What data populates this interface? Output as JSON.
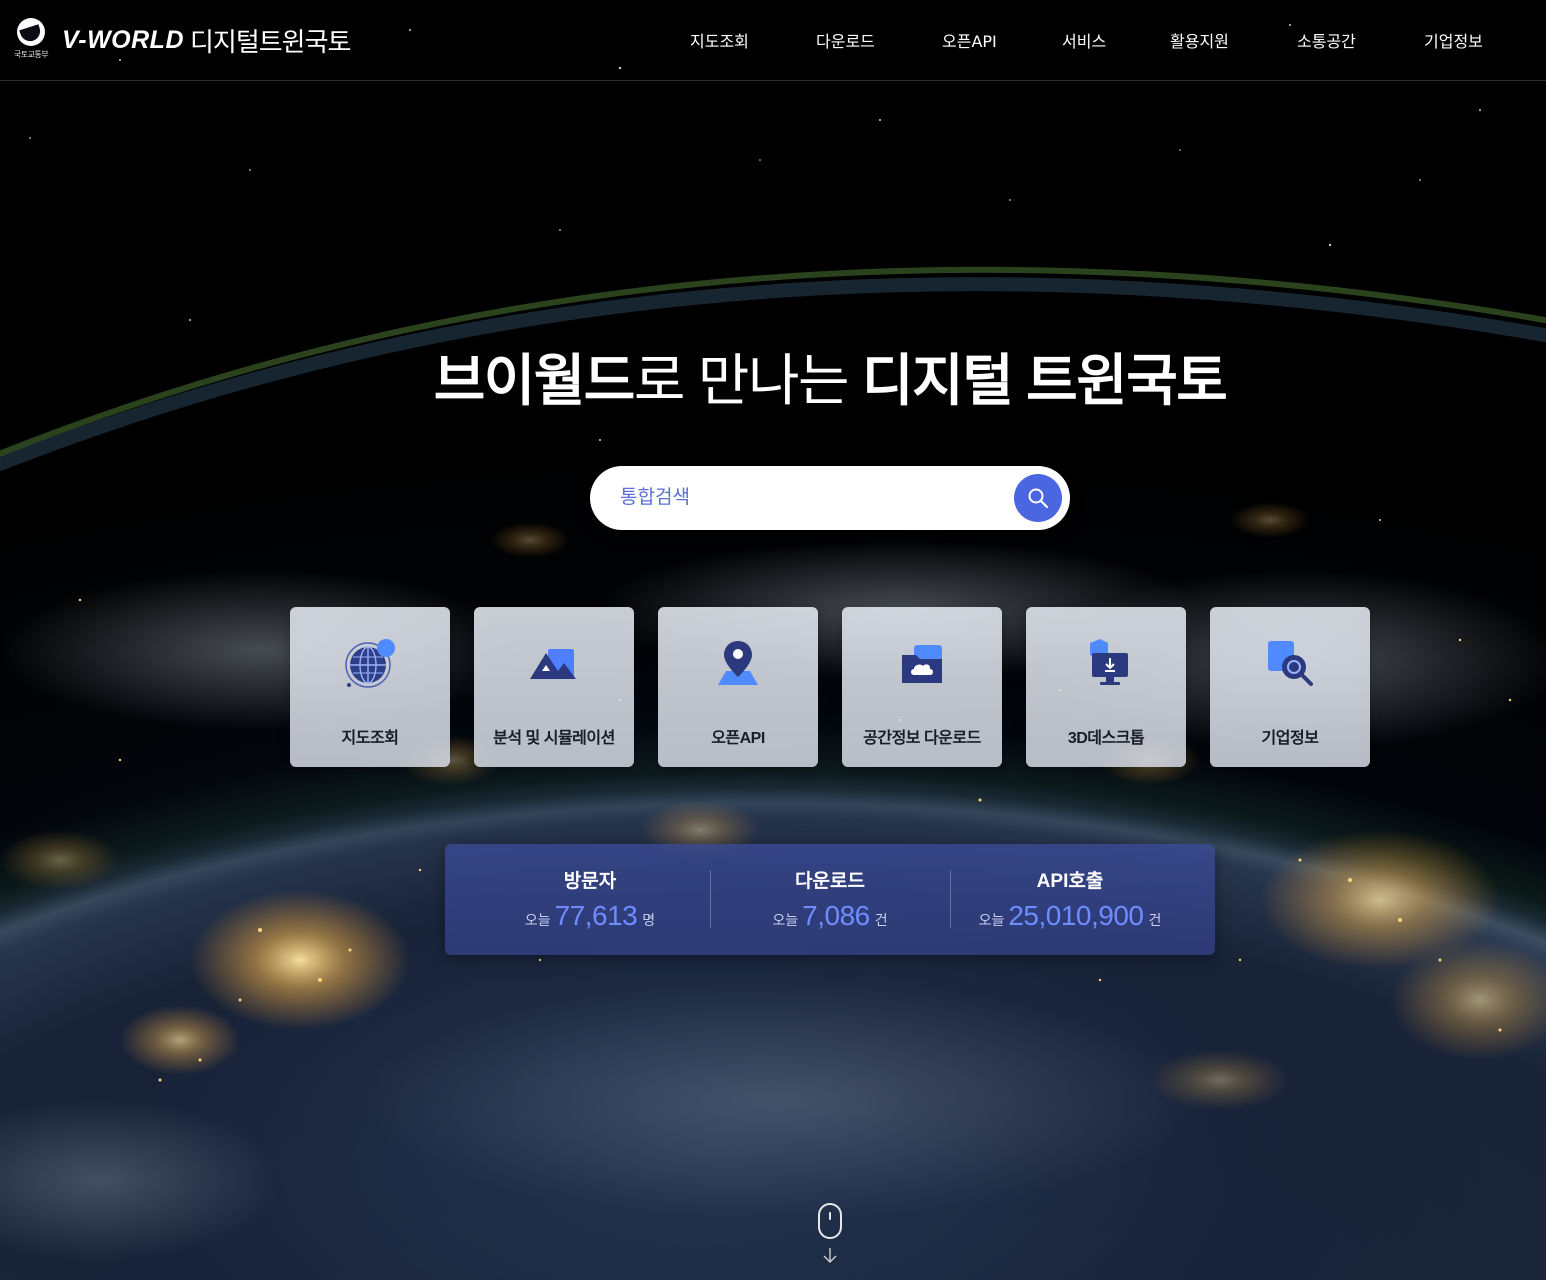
{
  "header": {
    "ministry_name": "국토교통부",
    "brand_name": "V-WORLD",
    "brand_sub": "디지털트윈국토",
    "nav": [
      "지도조회",
      "다운로드",
      "오픈API",
      "서비스",
      "활용지원",
      "소통공간",
      "기업정보"
    ]
  },
  "hero": {
    "title_part1": "브이월드",
    "title_part2": "로 만나는 ",
    "title_part3": "디지털 트윈국토"
  },
  "search": {
    "placeholder": "통합검색"
  },
  "quick_menu": [
    {
      "label": "지도조회",
      "icon": "globe-icon"
    },
    {
      "label": "분석 및 시뮬레이션",
      "icon": "mountain-icon"
    },
    {
      "label": "오픈API",
      "icon": "map-pin-icon"
    },
    {
      "label": "공간정보 다운로드",
      "icon": "cloud-folder-icon"
    },
    {
      "label": "3D데스크톱",
      "icon": "monitor-download-icon"
    },
    {
      "label": "기업정보",
      "icon": "search-document-icon"
    }
  ],
  "stats": [
    {
      "title": "방문자",
      "today_label": "오늘",
      "value": "77,613",
      "unit": "명"
    },
    {
      "title": "다운로드",
      "today_label": "오늘",
      "value": "7,086",
      "unit": "건"
    },
    {
      "title": "API호출",
      "today_label": "오늘",
      "value": "25,010,900",
      "unit": "건"
    }
  ],
  "colors": {
    "accent": "#4a66e0",
    "stat_number": "#6f8cff",
    "stats_panel": "#3a4a96",
    "card_bg": "#dde1ea"
  }
}
